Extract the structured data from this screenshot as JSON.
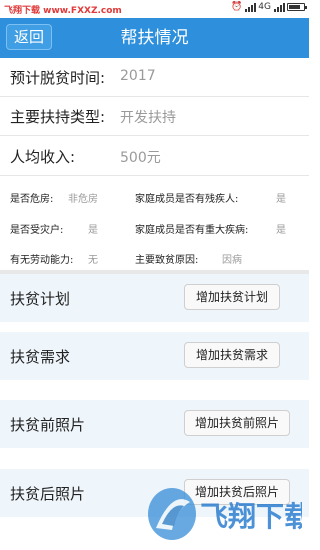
{
  "status_bar": {
    "watermark_text": "飞翔下载 www.FXXZ.com",
    "network": "4G",
    "icons": [
      "alarm-icon",
      "signal-icon",
      "battery-icon"
    ]
  },
  "header": {
    "back_label": "返回",
    "title": "帮扶情况",
    "accent_color": "#2e90dc"
  },
  "info": {
    "exit_poverty_label": "预计脱贫时间:",
    "exit_poverty_value": "2017",
    "aid_type_label": "主要扶持类型:",
    "aid_type_value": "开发扶持",
    "income_label": "人均收入:",
    "income_value": "500元"
  },
  "details": {
    "dangerous_house_label": "是否危房:",
    "dangerous_house_value": "非危房",
    "disabled_member_label": "家庭成员是否有残疾人:",
    "disabled_member_value": "是",
    "disaster_label": "是否受灾户:",
    "disaster_value": "是",
    "serious_illness_label": "家庭成员是否有重大疾病:",
    "serious_illness_value": "是",
    "labor_ability_label": "有无劳动能力:",
    "labor_ability_value": "无",
    "poverty_cause_label": "主要致贫原因:",
    "poverty_cause_value": "因病"
  },
  "sections": [
    {
      "label": "扶贫计划",
      "button": "增加扶贫计划"
    },
    {
      "label": "扶贫需求",
      "button": "增加扶贫需求"
    },
    {
      "label": "扶贫前照片",
      "button": "增加扶贫前照片"
    },
    {
      "label": "扶贫后照片",
      "button": "增加扶贫后照片"
    }
  ],
  "watermark": {
    "logo_text": "飞翔下载"
  }
}
